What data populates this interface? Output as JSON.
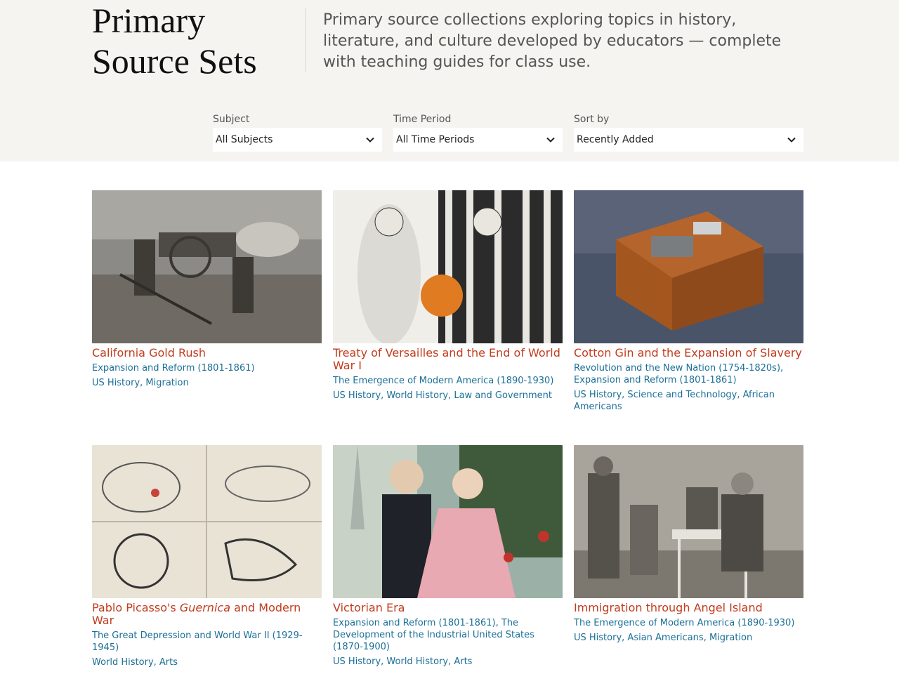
{
  "header": {
    "title_line1": "Primary",
    "title_line2": "Source Sets",
    "intro": "Primary source collections exploring topics in history, literature, and culture developed by educators — complete with teaching guides for class use."
  },
  "filters": {
    "subject": {
      "label": "Subject",
      "value": "All Subjects"
    },
    "time_period": {
      "label": "Time Period",
      "value": "All Time Periods"
    },
    "sort": {
      "label": "Sort by",
      "value": "Recently Added"
    }
  },
  "cards": [
    {
      "title": "California Gold Rush",
      "periods": [
        "Expansion and Reform (1801-1861)"
      ],
      "subjects": [
        "US History",
        "Migration"
      ]
    },
    {
      "title": "Treaty of Versailles and the End of World War I",
      "periods": [
        "The Emergence of Modern America (1890-1930)"
      ],
      "subjects": [
        "US History",
        "World History",
        "Law and Government"
      ]
    },
    {
      "title": "Cotton Gin and the Expansion of Slavery",
      "periods": [
        "Revolution and the New Nation (1754-1820s)",
        "Expansion and Reform (1801-1861)"
      ],
      "subjects": [
        "US History",
        "Science and Technology",
        "African Americans"
      ]
    },
    {
      "title_pre": "Pablo Picasso's ",
      "title_em": "Guernica",
      "title_post": " and Modern War",
      "periods": [
        "The Great Depression and World War II (1929-1945)"
      ],
      "subjects": [
        "World History",
        "Arts"
      ]
    },
    {
      "title": "Victorian Era",
      "periods": [
        "Expansion and Reform (1801-1861)",
        "The Development of the Industrial United States (1870-1900)"
      ],
      "subjects": [
        "US History",
        "World History",
        "Arts"
      ]
    },
    {
      "title": "Immigration through Angel Island",
      "periods": [
        "The Emergence of Modern America (1890-1930)"
      ],
      "subjects": [
        "US History",
        "Asian Americans",
        "Migration"
      ]
    }
  ]
}
